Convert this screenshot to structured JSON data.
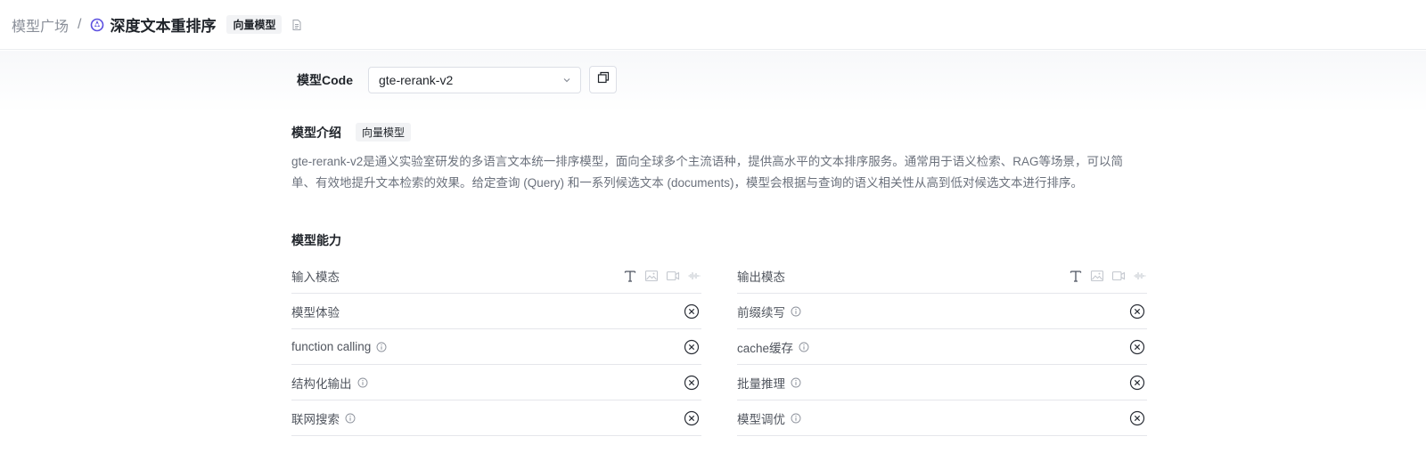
{
  "breadcrumb": {
    "root": "模型广场",
    "separator": "/",
    "title": "深度文本重排序",
    "tag": "向量模型"
  },
  "model_code": {
    "label": "模型Code",
    "selected": "gte-rerank-v2"
  },
  "intro": {
    "heading": "模型介绍",
    "tag": "向量模型",
    "description": "gte-rerank-v2是通义实验室研发的多语言文本统一排序模型，面向全球多个主流语种，提供高水平的文本排序服务。通常用于语义检索、RAG等场景，可以简单、有效地提升文本检索的效果。给定查询 (Query) 和一系列候选文本 (documents)，模型会根据与查询的语义相关性从高到低对候选文本进行排序。"
  },
  "capabilities": {
    "heading": "模型能力",
    "left": {
      "modality_label": "输入模态",
      "rows": [
        {
          "label": "模型体验",
          "info": false,
          "status": "unsupported"
        },
        {
          "label": "function calling",
          "info": true,
          "status": "unsupported"
        },
        {
          "label": "结构化输出",
          "info": true,
          "status": "unsupported"
        },
        {
          "label": "联网搜索",
          "info": true,
          "status": "unsupported"
        }
      ]
    },
    "right": {
      "modality_label": "输出模态",
      "rows": [
        {
          "label": "前缀续写",
          "info": true,
          "status": "unsupported"
        },
        {
          "label": "cache缓存",
          "info": true,
          "status": "unsupported"
        },
        {
          "label": "批量推理",
          "info": true,
          "status": "unsupported"
        },
        {
          "label": "模型调优",
          "info": true,
          "status": "unsupported"
        }
      ]
    },
    "modality_icons": [
      "text-icon",
      "image-icon",
      "video-icon",
      "audio-icon"
    ]
  },
  "colors": {
    "brand": "#5b4fe0",
    "text_primary": "#1f2329",
    "text_secondary": "#6b717c",
    "modality_active": "#4e5461",
    "modality_inactive": "#c4c8cf"
  }
}
